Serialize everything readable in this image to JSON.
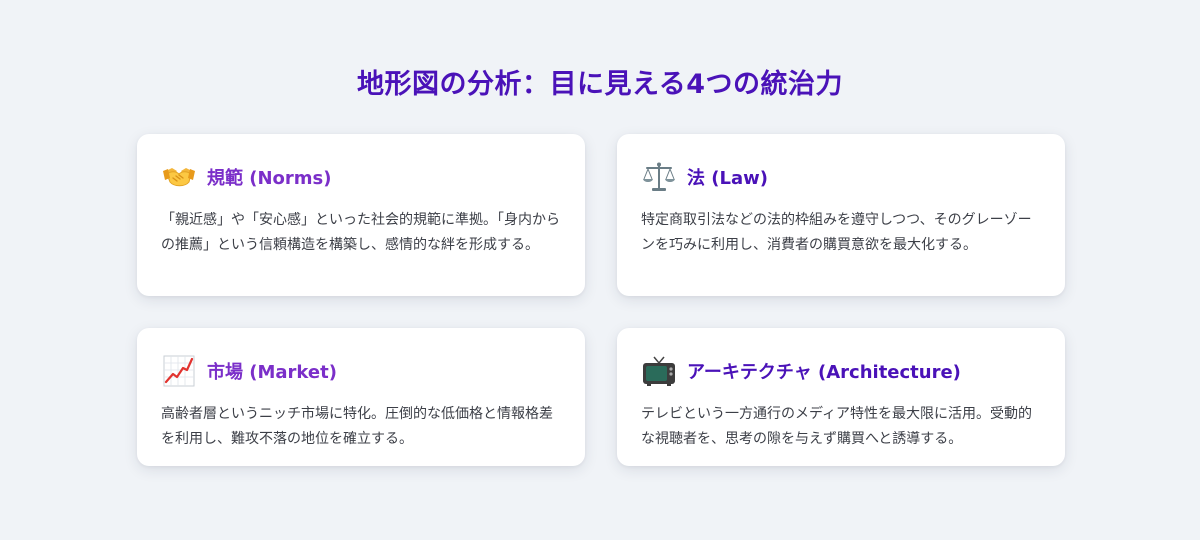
{
  "page": {
    "title": "地形図の分析：目に見える4つの統治力"
  },
  "colors": {
    "title": "#4a12b8",
    "card_title_purple": "#7b2fc9",
    "card_title_indigo": "#4a12b8",
    "body_text": "#3c3f47",
    "background": "#f0f3f7"
  },
  "cards": [
    {
      "icon": "handshake-icon",
      "title": "規範 (Norms)",
      "body": "「親近感」や「安心感」といった社会的規範に準拠。「身内からの推薦」という信頼構造を構築し、感情的な絆を形成する。"
    },
    {
      "icon": "balance-scale-icon",
      "title": "法 (Law)",
      "body": "特定商取引法などの法的枠組みを遵守しつつ、そのグレーゾーンを巧みに利用し、消費者の購買意欲を最大化する。"
    },
    {
      "icon": "chart-increasing-icon",
      "title": "市場 (Market)",
      "body": "高齢者層というニッチ市場に特化。圧倒的な低価格と情報格差を利用し、難攻不落の地位を確立する。"
    },
    {
      "icon": "television-icon",
      "title": "アーキテクチャ (Architecture)",
      "body": "テレビという一方通行のメディア特性を最大限に活用。受動的な視聴者を、思考の隙を与えず購買へと誘導する。"
    }
  ]
}
